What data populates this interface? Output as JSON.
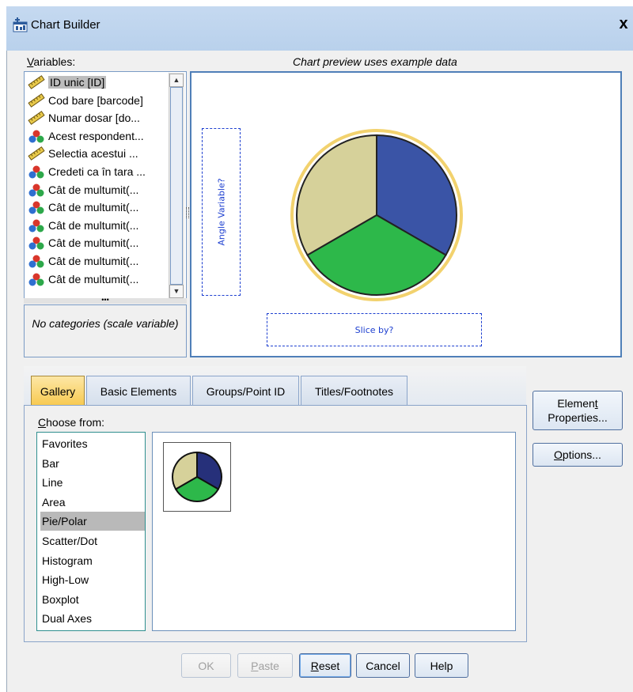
{
  "window": {
    "title": "Chart Builder",
    "close_glyph": "x"
  },
  "variables": {
    "label": "Variables:",
    "label_hotkey": "V",
    "label_rest": "ariables:",
    "items": [
      {
        "label": "ID unic [ID]",
        "icon": "scale-ruler-icon"
      },
      {
        "label": "Cod bare [barcode]",
        "icon": "scale-ruler-icon"
      },
      {
        "label": "Numar dosar [do...",
        "icon": "scale-ruler-icon"
      },
      {
        "label": "Acest respondent...",
        "icon": "nominal-balls-icon"
      },
      {
        "label": "Selectia acestui ...",
        "icon": "scale-ruler-icon"
      },
      {
        "label": "Credeti ca în tara ...",
        "icon": "nominal-balls-icon"
      },
      {
        "label": "Cât de multumit(...",
        "icon": "nominal-balls-icon"
      },
      {
        "label": "Cât de multumit(...",
        "icon": "nominal-balls-icon"
      },
      {
        "label": "Cât de multumit(...",
        "icon": "nominal-balls-icon"
      },
      {
        "label": "Cât de multumit(...",
        "icon": "nominal-balls-icon"
      },
      {
        "label": "Cât de multumit(...",
        "icon": "nominal-balls-icon"
      },
      {
        "label": "Cât de multumit(...",
        "icon": "nominal-balls-icon"
      }
    ],
    "category_note": "No categories (scale variable)"
  },
  "preview": {
    "caption": "Chart preview uses example data",
    "angle_drop": "Angle Variable?",
    "slice_drop": "Slice by?",
    "pie_colors": [
      "#3a54a6",
      "#2db84a",
      "#d6d19a"
    ]
  },
  "tabs": [
    {
      "label": "Gallery",
      "active": true
    },
    {
      "label": "Basic Elements",
      "active": false
    },
    {
      "label": "Groups/Point ID",
      "active": false
    },
    {
      "label": "Titles/Footnotes",
      "active": false
    }
  ],
  "gallery": {
    "choose_label": "Choose from:",
    "choose_hotkey": "C",
    "choose_rest": "hoose from:",
    "items": [
      "Favorites",
      "Bar",
      "Line",
      "Area",
      "Pie/Polar",
      "Scatter/Dot",
      "Histogram",
      "High-Low",
      "Boxplot",
      "Dual Axes"
    ],
    "selected": "Pie/Polar",
    "thumbnail_colors": [
      "#26307a",
      "#2db84a",
      "#d6d19a"
    ]
  },
  "side_buttons": {
    "element_properties_line1": "Elemen",
    "element_properties_hotkey": "t",
    "element_properties_line2": "Properties...",
    "options_hotkey": "O",
    "options_rest": "ptions..."
  },
  "bottom_buttons": {
    "ok": "OK",
    "paste_hotkey": "P",
    "paste_rest": "aste",
    "reset_hotkey": "R",
    "reset_rest": "eset",
    "cancel": "Cancel",
    "help": "Help"
  }
}
